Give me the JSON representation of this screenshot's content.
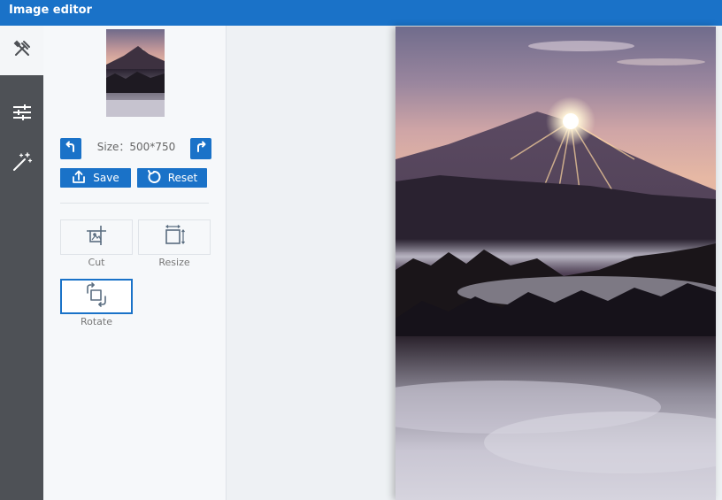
{
  "window": {
    "title": "Image editor"
  },
  "sidebar": {
    "items": [
      {
        "icon": "tools-icon",
        "active": true
      },
      {
        "icon": "sliders-icon",
        "active": false
      },
      {
        "icon": "magic-wand-icon",
        "active": false
      }
    ]
  },
  "panel": {
    "size_label": "Size：500*750",
    "save_label": "Save",
    "reset_label": "Reset",
    "tools": [
      {
        "label": "Cut",
        "icon": "crop-icon"
      },
      {
        "label": "Resize",
        "icon": "resize-icon"
      },
      {
        "label": "Rotate",
        "icon": "rotate-icon",
        "selected": true
      }
    ]
  },
  "colors": {
    "accent": "#1a72c8",
    "rail": "#4e5156",
    "panel": "#f6f8fa"
  }
}
